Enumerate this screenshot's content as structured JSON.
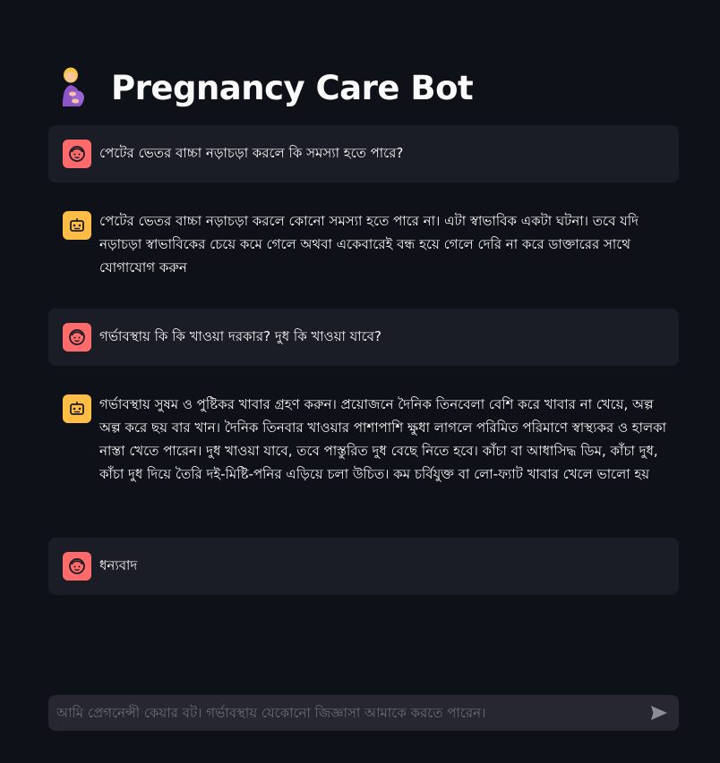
{
  "app": {
    "title": "Pregnancy Care Bot",
    "title_icon": "pregnant-person-emoji"
  },
  "messages": [
    {
      "role": "user",
      "avatar_icon": "user-face-icon",
      "text": "পেটের ভেতর বাচ্চা নড়াচড়া করলে কি সমস্যা হতে পারে?"
    },
    {
      "role": "assistant",
      "avatar_icon": "robot-face-icon",
      "text": "পেটের ভেতর বাচ্চা নড়াচড়া করলে কোনো সমস্যা হতে পারে না। এটা স্বাভাবিক একটা ঘটনা। তবে যদি নড়াচড়া স্বাভাবিকের চেয়ে কমে গেলে অথবা একেবারেই বন্ধ হয়ে গেলে দেরি না করে ডাক্তারের সাথে যোগাযোগ করুন"
    },
    {
      "role": "user",
      "avatar_icon": "user-face-icon",
      "text": "গর্ভাবস্থায় কি কি খাওয়া দরকার? দুধ কি খাওয়া যাবে?"
    },
    {
      "role": "assistant",
      "avatar_icon": "robot-face-icon",
      "text": "গর্ভাবস্থায় সুষম ও পুষ্টিকর খাবার গ্রহণ করুন। প্রয়োজনে দৈনিক তিনবেলা বেশি করে খাবার না খেয়ে, অল্প অল্প করে ছয় বার খান। দৈনিক তিনবার খাওয়ার পাশাপাশি ক্ষুধা লাগলে পরিমিত পরিমাণে স্বাস্থ্যকর ও হালকা নাস্তা খেতে পারেন। দুধ খাওয়া যাবে, তবে পাস্তুরিত দুধ বেছে নিতে হবে। কাঁচা বা আধাসিদ্ধ ডিম, কাঁচা দুধ, কাঁচা দুধ দিয়ে তৈরি দই-মিষ্টি-পনির এড়িয়ে চলা উচিত। কম চর্বিযুক্ত বা লো-ফ্যাট খাবার খেলে ভালো হয়"
    },
    {
      "role": "user",
      "avatar_icon": "user-face-icon",
      "text": "ধন্যবাদ"
    }
  ],
  "chat_input": {
    "placeholder": "আমি প্রেগনেন্সী কেয়ার বট। গর্ভাবস্থায় যেকোনো জিজ্ঞাসা আমাকে করতে পারেন।",
    "value": "",
    "send_icon": "send-arrow-icon"
  },
  "colors": {
    "background": "#0e1117",
    "user_message_bg": "#1b1d26",
    "user_avatar": "#ff6b6b",
    "bot_avatar": "#ffbd45",
    "input_bg": "#262730",
    "text": "#fafafa"
  }
}
